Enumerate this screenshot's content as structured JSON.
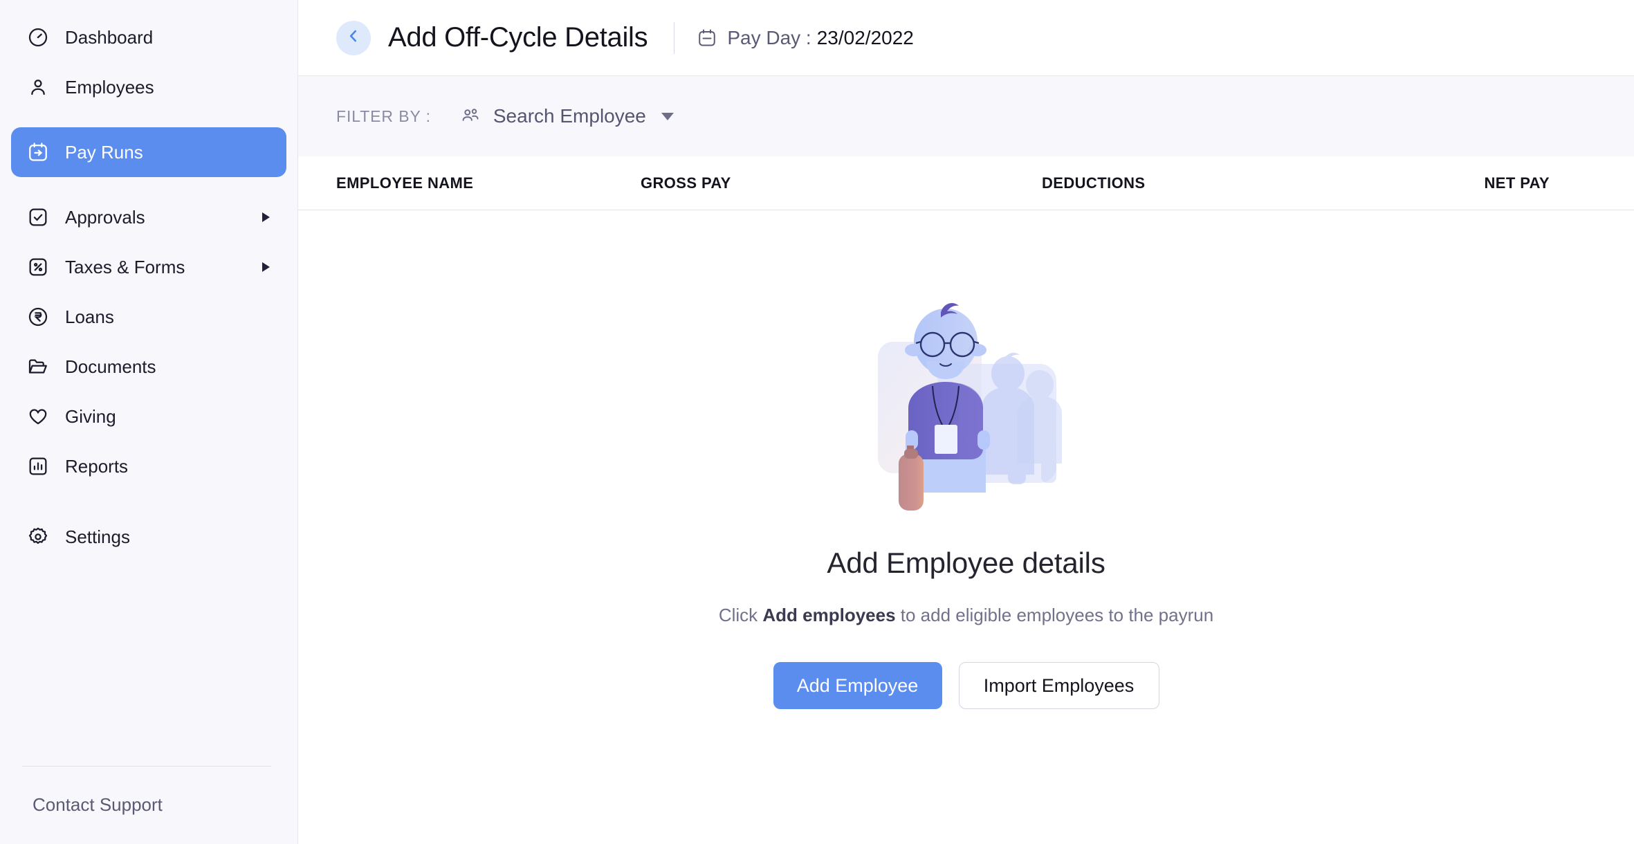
{
  "colors": {
    "accent": "#5B8DEF",
    "sidebar_bg": "#F7F7FC",
    "filterbar_bg": "#F8F8FC",
    "text_primary": "#14141E",
    "text_muted": "#71718A",
    "back_btn_bg": "#DEE9FB"
  },
  "sidebar": {
    "items": [
      {
        "label": "Dashboard",
        "icon": "gauge-icon",
        "active": false,
        "has_caret": false
      },
      {
        "label": "Employees",
        "icon": "person-icon",
        "active": false,
        "has_caret": false
      },
      {
        "label": "Pay Runs",
        "icon": "calendar-arrow-icon",
        "active": true,
        "has_caret": false
      },
      {
        "label": "Approvals",
        "icon": "check-square-icon",
        "active": false,
        "has_caret": true
      },
      {
        "label": "Taxes & Forms",
        "icon": "percent-square-icon",
        "active": false,
        "has_caret": true
      },
      {
        "label": "Loans",
        "icon": "rupee-circle-icon",
        "active": false,
        "has_caret": false
      },
      {
        "label": "Documents",
        "icon": "folder-icon",
        "active": false,
        "has_caret": false
      },
      {
        "label": "Giving",
        "icon": "heart-icon",
        "active": false,
        "has_caret": false
      },
      {
        "label": "Reports",
        "icon": "bar-chart-icon",
        "active": false,
        "has_caret": false
      },
      {
        "label": "Settings",
        "icon": "gear-icon",
        "active": false,
        "has_caret": false
      }
    ],
    "contact_support": "Contact Support"
  },
  "header": {
    "back_icon": "chevron-left-icon",
    "title": "Add Off-Cycle Details",
    "payday_icon": "calendar-icon",
    "payday_label": "Pay Day :",
    "payday_value": "23/02/2022"
  },
  "filter": {
    "label": "FILTER BY :",
    "icon": "users-icon",
    "selected": "Search Employee",
    "caret_icon": "chevron-down-icon"
  },
  "table": {
    "columns": [
      "EMPLOYEE NAME",
      "GROSS PAY",
      "DEDUCTIONS",
      "NET PAY"
    ],
    "rows": []
  },
  "empty_state": {
    "illustration": "employee-with-badge-and-briefcase-illustration",
    "title": "Add Employee details",
    "subtitle_prefix": "Click ",
    "subtitle_bold": "Add employees",
    "subtitle_suffix": " to add eligible employees to the payrun",
    "primary_button": "Add Employee",
    "secondary_button": "Import Employees"
  }
}
